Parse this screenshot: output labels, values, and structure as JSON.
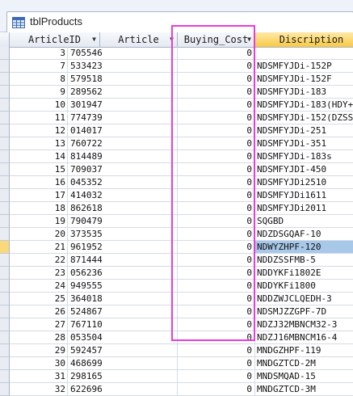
{
  "table": {
    "title": "tblProducts",
    "columns": [
      {
        "label": "ArticleID"
      },
      {
        "label": "Article"
      },
      {
        "label": "Buying_Cost"
      },
      {
        "label": "Discription"
      }
    ],
    "rows": [
      {
        "id": "3",
        "article": "705546",
        "cost": "0",
        "desc": ""
      },
      {
        "id": "7",
        "article": "533423",
        "cost": "0",
        "desc": "NDSMFYJDi-152P"
      },
      {
        "id": "8",
        "article": "579518",
        "cost": "0",
        "desc": "NDSMFYJDi-152F"
      },
      {
        "id": "9",
        "article": "289562",
        "cost": "0",
        "desc": "NDSMFYJDi-183"
      },
      {
        "id": "10",
        "article": "301947",
        "cost": "0",
        "desc": "NDSMFYJDi-183(HDY+S"
      },
      {
        "id": "11",
        "article": "774739",
        "cost": "0",
        "desc": "NDSMFYJDi-152(DZSS)"
      },
      {
        "id": "12",
        "article": "014017",
        "cost": "0",
        "desc": "NDSMFYJDi-251"
      },
      {
        "id": "13",
        "article": "760722",
        "cost": "0",
        "desc": "NDSMFYJDi-351"
      },
      {
        "id": "14",
        "article": "814489",
        "cost": "0",
        "desc": "NDSMFYJDi-183s"
      },
      {
        "id": "15",
        "article": "709037",
        "cost": "0",
        "desc": "NDSMFYJDI-450"
      },
      {
        "id": "16",
        "article": "045352",
        "cost": "0",
        "desc": "NDSMFYJDi2510"
      },
      {
        "id": "17",
        "article": "414032",
        "cost": "0",
        "desc": "NDSMFYJDi1611"
      },
      {
        "id": "18",
        "article": "862618",
        "cost": "0",
        "desc": "NDSMFYJDi2011"
      },
      {
        "id": "19",
        "article": "790479",
        "cost": "0",
        "desc": "SQGBD"
      },
      {
        "id": "20",
        "article": "373535",
        "cost": "0",
        "desc": "NDZDSGQAF-10"
      },
      {
        "id": "21",
        "article": "961952",
        "cost": "0",
        "desc": "NDWYZHPF-120"
      },
      {
        "id": "22",
        "article": "871444",
        "cost": "0",
        "desc": "NDDZSSFMB-5"
      },
      {
        "id": "23",
        "article": "056236",
        "cost": "0",
        "desc": "NDDYKFi1802E"
      },
      {
        "id": "24",
        "article": "949555",
        "cost": "0",
        "desc": "NDDYKFi1800"
      },
      {
        "id": "25",
        "article": "364018",
        "cost": "0",
        "desc": "NDDZWJCLQEDH-3"
      },
      {
        "id": "26",
        "article": "524867",
        "cost": "0",
        "desc": "NDSMJZZGPF-7D"
      },
      {
        "id": "27",
        "article": "767110",
        "cost": "0",
        "desc": "NDZJ32MBNCM32-3"
      },
      {
        "id": "28",
        "article": "053504",
        "cost": "0",
        "desc": "NDZJ16MBNCM16-4"
      },
      {
        "id": "29",
        "article": "592457",
        "cost": "0",
        "desc": "MNDGZHPF-119"
      },
      {
        "id": "30",
        "article": "468699",
        "cost": "0",
        "desc": "MNDGZTCD-2M"
      },
      {
        "id": "31",
        "article": "298165",
        "cost": "0",
        "desc": "MNDSMQAD-15"
      },
      {
        "id": "32",
        "article": "622696",
        "cost": "0",
        "desc": "MNDGZTCD-3M"
      }
    ]
  },
  "colors": {
    "highlight": "#e83cdb",
    "active_header": "#f7c945",
    "current_row_selector": "#fbd87a"
  },
  "icons": {
    "table": "table-icon",
    "dropdown": "dropdown-arrow-icon"
  }
}
